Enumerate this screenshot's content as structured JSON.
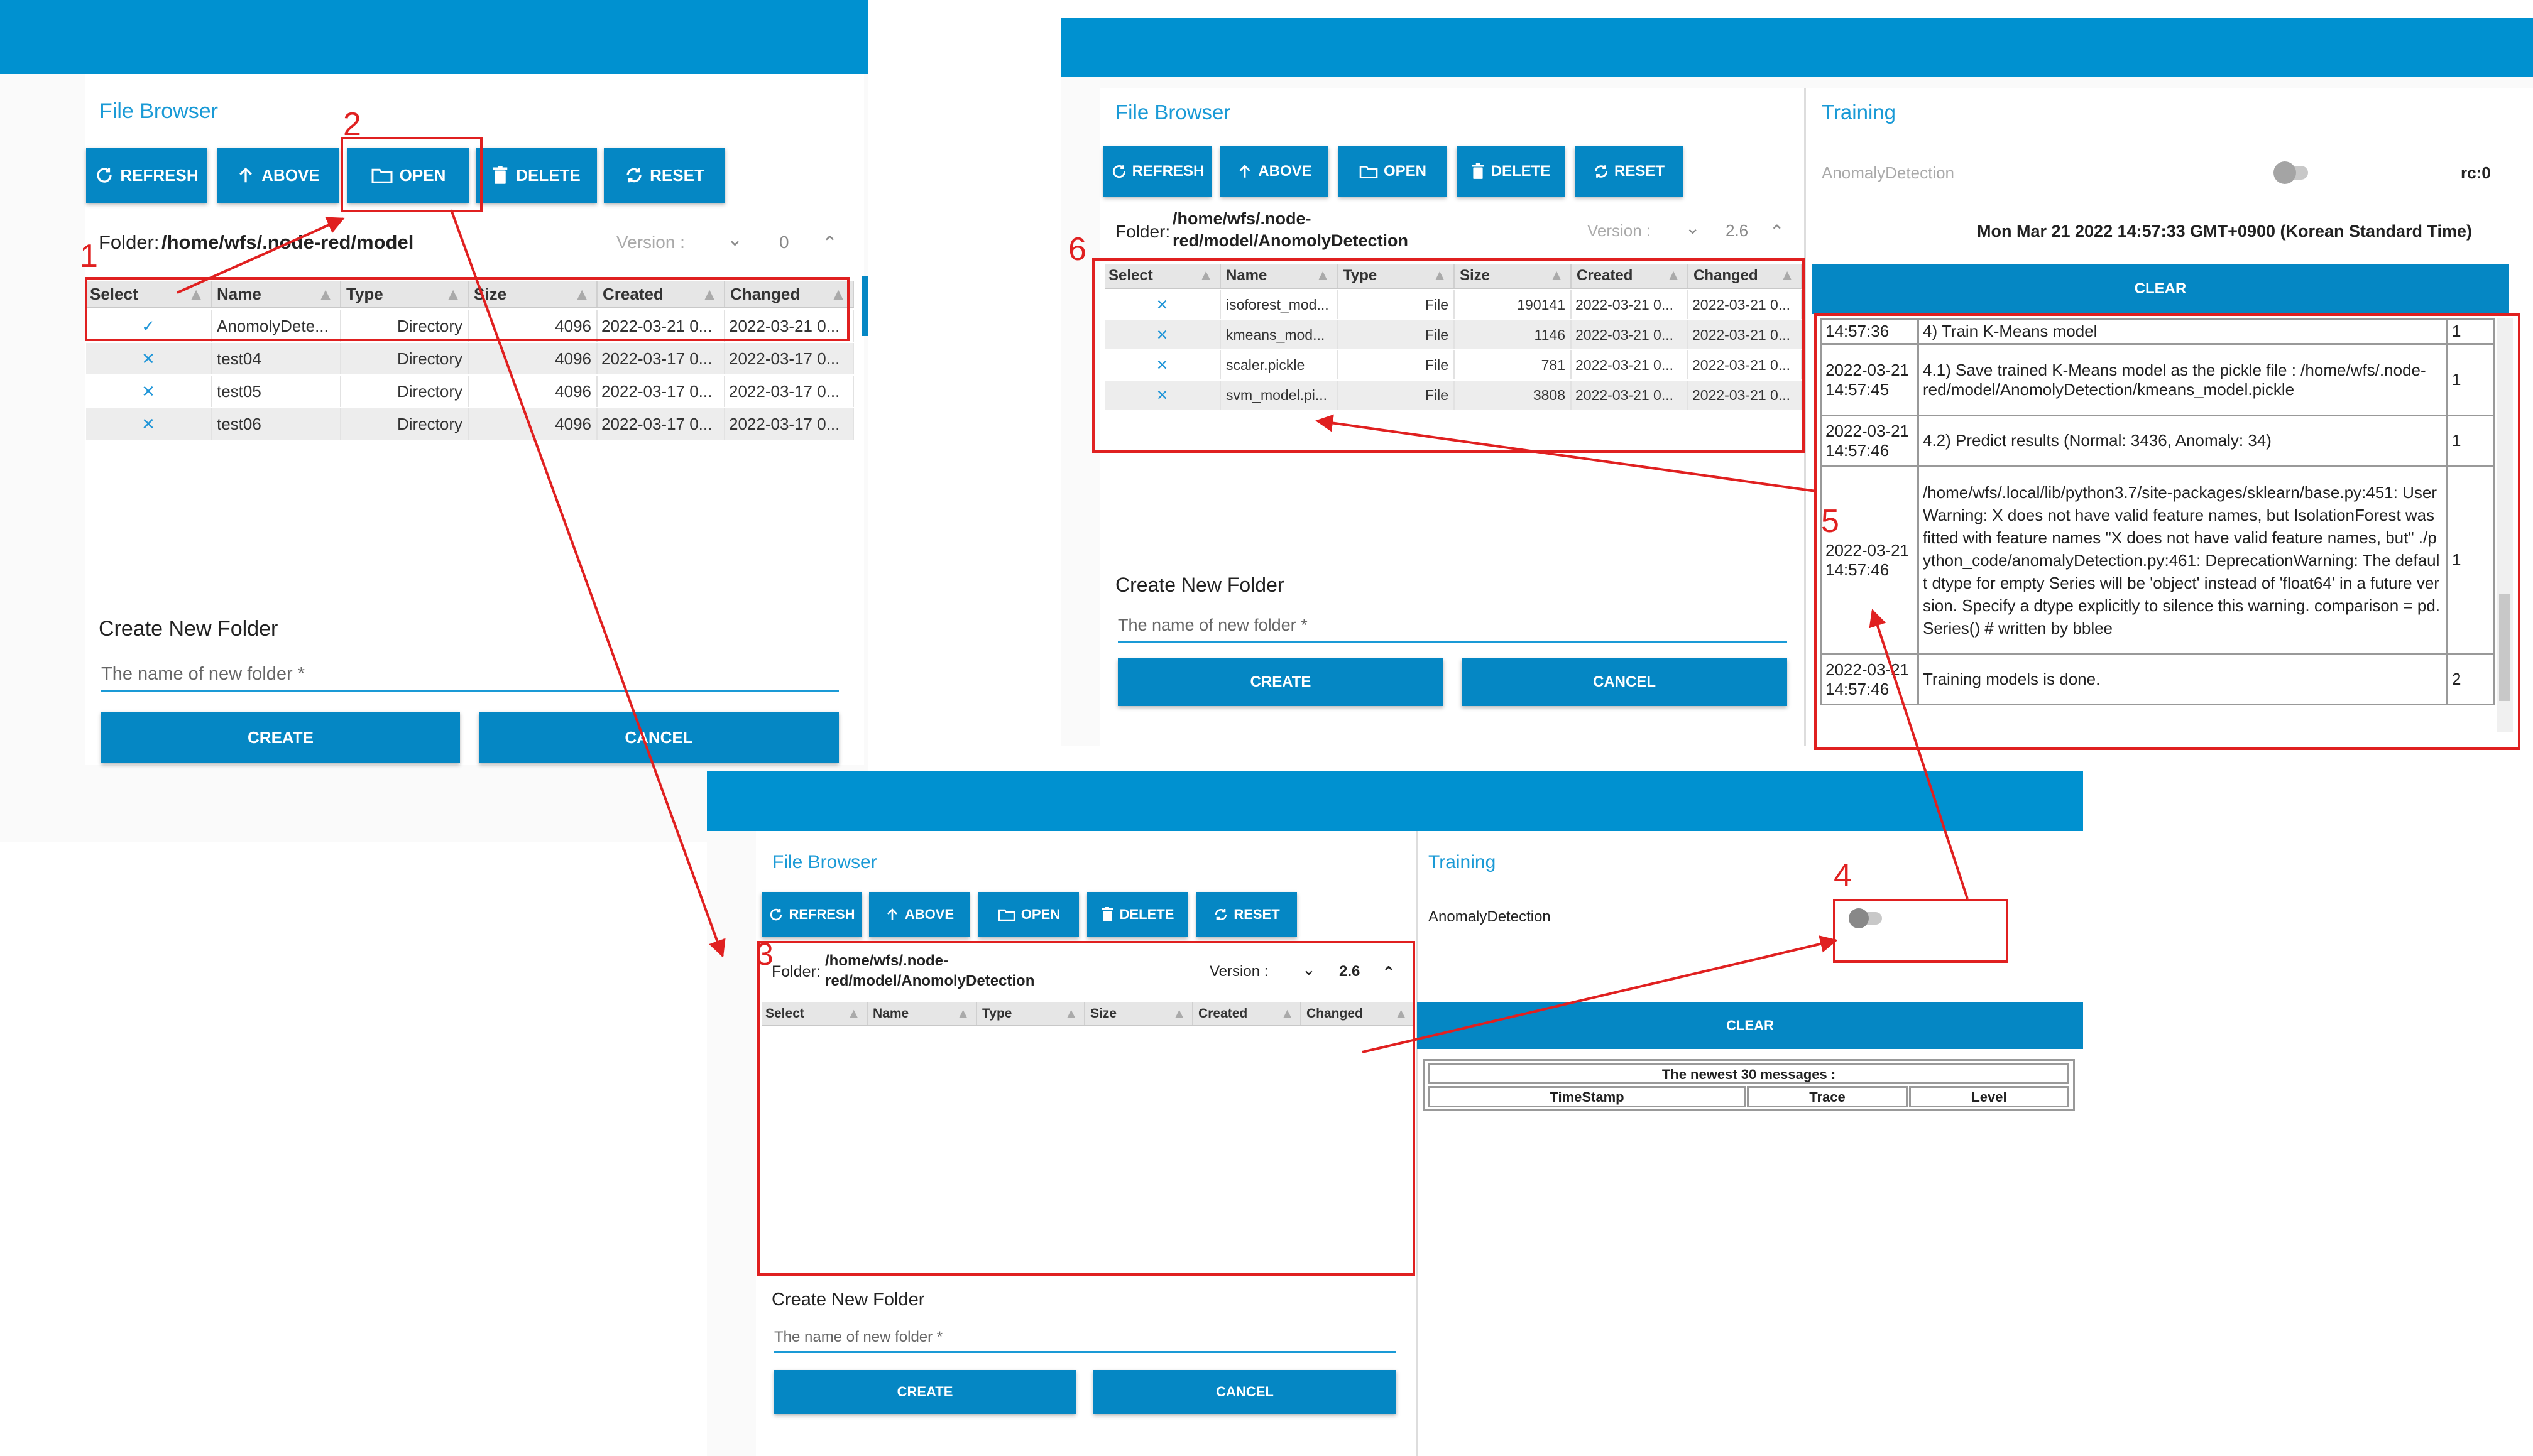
{
  "panel_a": {
    "title": "File Browser",
    "buttons": {
      "refresh": "REFRESH",
      "above": "ABOVE",
      "open": "OPEN",
      "delete": "DELETE",
      "reset": "RESET"
    },
    "folder_label": "Folder:",
    "folder_path": "/home/wfs/.node-red/model",
    "version_label": "Version :",
    "version_value": "0",
    "columns": [
      "Select",
      "Name",
      "Type",
      "Size",
      "Created",
      "Changed"
    ],
    "rows": [
      {
        "select": "✓",
        "name": "AnomolyDete...",
        "type": "Directory",
        "size": "4096",
        "created": "2022-03-21 0...",
        "changed": "2022-03-21 0..."
      },
      {
        "select": "✕",
        "name": "test04",
        "type": "Directory",
        "size": "4096",
        "created": "2022-03-17 0...",
        "changed": "2022-03-17 0..."
      },
      {
        "select": "✕",
        "name": "test05",
        "type": "Directory",
        "size": "4096",
        "created": "2022-03-17 0...",
        "changed": "2022-03-17 0..."
      },
      {
        "select": "✕",
        "name": "test06",
        "type": "Directory",
        "size": "4096",
        "created": "2022-03-17 0...",
        "changed": "2022-03-17 0..."
      }
    ],
    "create_new_folder": "Create New Folder",
    "new_folder_placeholder": "The name of new folder *",
    "create": "CREATE",
    "cancel": "CANCEL"
  },
  "panel_b": {
    "title": "File Browser",
    "buttons": {
      "refresh": "REFRESH",
      "above": "ABOVE",
      "open": "OPEN",
      "delete": "DELETE",
      "reset": "RESET"
    },
    "folder_label": "Folder:",
    "folder_path_1": "/home/wfs/.node-",
    "folder_path_2": "red/model/AnomolyDetection",
    "version_label": "Version :",
    "version_value": "2.6",
    "columns": [
      "Select",
      "Name",
      "Type",
      "Size",
      "Created",
      "Changed"
    ],
    "rows": [
      {
        "select": "✕",
        "name": "isoforest_mod...",
        "type": "File",
        "size": "190141",
        "created": "2022-03-21 0...",
        "changed": "2022-03-21 0..."
      },
      {
        "select": "✕",
        "name": "kmeans_mod...",
        "type": "File",
        "size": "1146",
        "created": "2022-03-21 0...",
        "changed": "2022-03-21 0..."
      },
      {
        "select": "✕",
        "name": "scaler.pickle",
        "type": "File",
        "size": "781",
        "created": "2022-03-21 0...",
        "changed": "2022-03-21 0..."
      },
      {
        "select": "✕",
        "name": "svm_model.pi...",
        "type": "File",
        "size": "3808",
        "created": "2022-03-21 0...",
        "changed": "2022-03-21 0..."
      }
    ],
    "create_new_folder": "Create New Folder",
    "new_folder_placeholder": "The name of new folder *",
    "create": "CREATE",
    "cancel": "CANCEL",
    "training": {
      "title": "Training",
      "toggle_label": "AnomalyDetection",
      "rc": "rc:0",
      "datetime": "Mon Mar 21 2022 14:57:33 GMT+0900 (Korean Standard Time)",
      "clear": "CLEAR",
      "log": [
        {
          "ts1": "",
          "ts2": "14:57:36",
          "trace": "4) Train K-Means model",
          "level": "1"
        },
        {
          "ts1": "2022-03-21",
          "ts2": "14:57:45",
          "trace": "4.1) Save trained K-Means model as the pickle file : /home/wfs/.node-red/model/AnomolyDetection/kmeans_model.pickle",
          "level": "1"
        },
        {
          "ts1": "2022-03-21",
          "ts2": "14:57:46",
          "trace": "4.2) Predict results (Normal: 3436, Anomaly: 34)",
          "level": "1"
        },
        {
          "ts1": "2022-03-21",
          "ts2": "14:57:46",
          "trace": "/home/wfs/.local/lib/python3.7/site-packages/sklearn/base.py:451: UserWarning: X does not have valid feature names, but IsolationForest was fitted with feature names \"X does not have valid feature names, but\" ./python_code/anomalyDetection.py:461: DeprecationWarning: The default dtype for empty Series will be 'object' instead of 'float64' in a future version. Specify a dtype explicitly to silence this warning. comparison = pd.Series() # written by bblee",
          "level": "1"
        },
        {
          "ts1": "2022-03-21",
          "ts2": "14:57:46",
          "trace": "Training models is done.",
          "level": "2"
        }
      ]
    }
  },
  "panel_c": {
    "title": "File Browser",
    "buttons": {
      "refresh": "REFRESH",
      "above": "ABOVE",
      "open": "OPEN",
      "delete": "DELETE",
      "reset": "RESET"
    },
    "folder_label": "Folder:",
    "folder_path_1": "/home/wfs/.node-",
    "folder_path_2": "red/model/AnomolyDetection",
    "version_label": "Version :",
    "version_value": "2.6",
    "columns": [
      "Select",
      "Name",
      "Type",
      "Size",
      "Created",
      "Changed"
    ],
    "create_new_folder": "Create New Folder",
    "new_folder_placeholder": "The name of new folder *",
    "create": "CREATE",
    "cancel": "CANCEL",
    "training": {
      "title": "Training",
      "toggle_label": "AnomalyDetection",
      "clear": "CLEAR",
      "newest_header": "The newest 30 messages :",
      "columns": [
        "TimeStamp",
        "Trace",
        "Level"
      ]
    }
  },
  "annotations": {
    "n1": "1",
    "n2": "2",
    "n3": "3",
    "n4": "4",
    "n5": "5",
    "n6": "6"
  },
  "colors": {
    "accent": "#0091d0",
    "button": "#0587c4",
    "annotation": "#e02020"
  },
  "icons": {
    "refresh": "refresh-icon",
    "above": "arrow-up-icon",
    "open": "folder-icon",
    "delete": "trash-icon",
    "reset": "reset-icon"
  }
}
